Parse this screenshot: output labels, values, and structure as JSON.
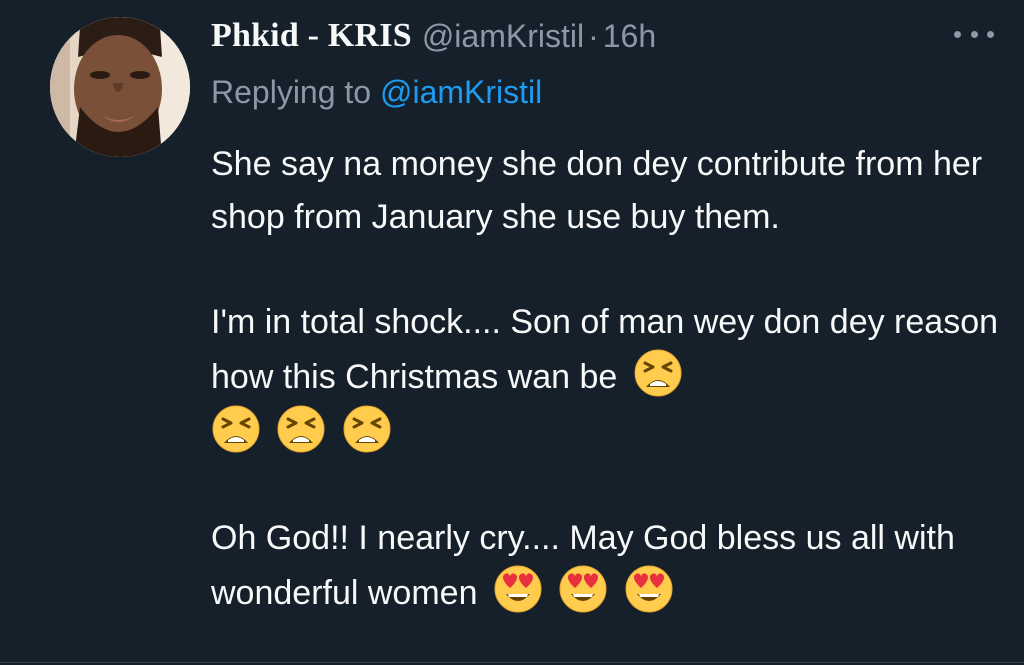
{
  "tweet": {
    "display_name": "Phkid - KRIS",
    "handle": "@iamKristil",
    "separator": "·",
    "time": "16h",
    "replying_prefix": "Replying to",
    "replying_to": "@iamKristil",
    "paragraphs": [
      {
        "text": "She say na money she don dey contribute from her shop from January she use buy them.",
        "emojis": []
      },
      {
        "text": "I'm in total shock.... Son of man wey don dey reason how this Christmas wan be",
        "emojis": [
          "tired-face-emoji",
          "tired-face-emoji",
          "tired-face-emoji",
          "tired-face-emoji"
        ]
      },
      {
        "text": "Oh God!! I nearly cry.... May God bless us all with wonderful women",
        "emojis": [
          "heart-eyes-emoji",
          "heart-eyes-emoji",
          "heart-eyes-emoji"
        ]
      }
    ]
  },
  "icons": {
    "more": "more-horizontal-icon",
    "avatar": "user-avatar-photo"
  },
  "colors": {
    "background": "#15202b",
    "primary_text": "#f7f9f9",
    "secondary_text": "#8b98a5",
    "link": "#1d9bf0",
    "emoji_face": "#ffcc4d",
    "emoji_heart": "#e8313f"
  }
}
